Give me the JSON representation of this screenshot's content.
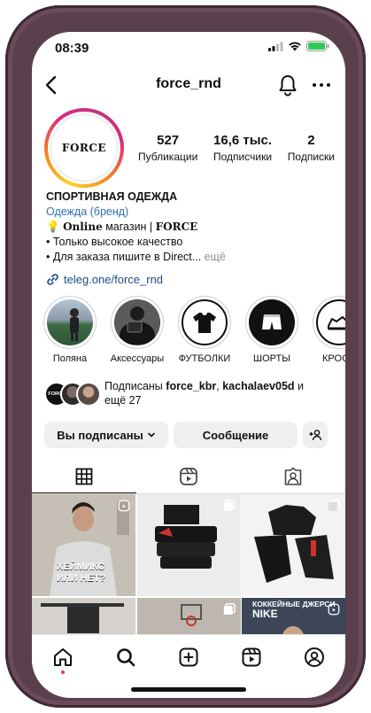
{
  "status": {
    "time": "08:39"
  },
  "nav": {
    "username": "force_rnd"
  },
  "profile": {
    "avatar_text": "FORCE",
    "stats": [
      {
        "num": "527",
        "label": "Публикации"
      },
      {
        "num": "16,6 тыс.",
        "label": "Подписчики"
      },
      {
        "num": "2",
        "label": "Подписки"
      }
    ],
    "name": "СПОРТИВНАЯ ОДЕЖДА",
    "category": "Одежда (бренд)",
    "bio_online": "Online",
    "bio_line1_rest": " магазин | ",
    "bio_brand": "FORCE",
    "bio_line2": "• Только высокое качество",
    "bio_line3": "• Для заказа пишите в Direct...",
    "bio_more": " ещё",
    "link": "teleg.one/force_rnd"
  },
  "highlights": [
    {
      "label": "Поляна"
    },
    {
      "label": "Аксессуары"
    },
    {
      "label": "ФУТБОЛКИ"
    },
    {
      "label": "ШОРТЫ"
    },
    {
      "label": "КРОСС"
    }
  ],
  "followed": {
    "prefix": "Подписаны ",
    "user1": "force_kbr",
    "sep": ", ",
    "user2": "kachalaev05d",
    "suffix": " и",
    "more": "ещё 27",
    "avatar_text": "FORCE"
  },
  "buttons": {
    "following": "Вы подписаны",
    "message": "Сообщение"
  },
  "grid": {
    "caption1_line1": "ХЕЙМИКС",
    "caption1_line2": "ИЛИ НЕТ?",
    "caption6_line1": "КОККЕЙНЫЕ ДЖЕРСИ",
    "caption6_line2": "NIKE"
  },
  "colors": {
    "link": "#1b4d8a",
    "category": "#2f6fb5",
    "notification_dot": "#ff3040",
    "phone_frame": "#5a3f4c"
  }
}
